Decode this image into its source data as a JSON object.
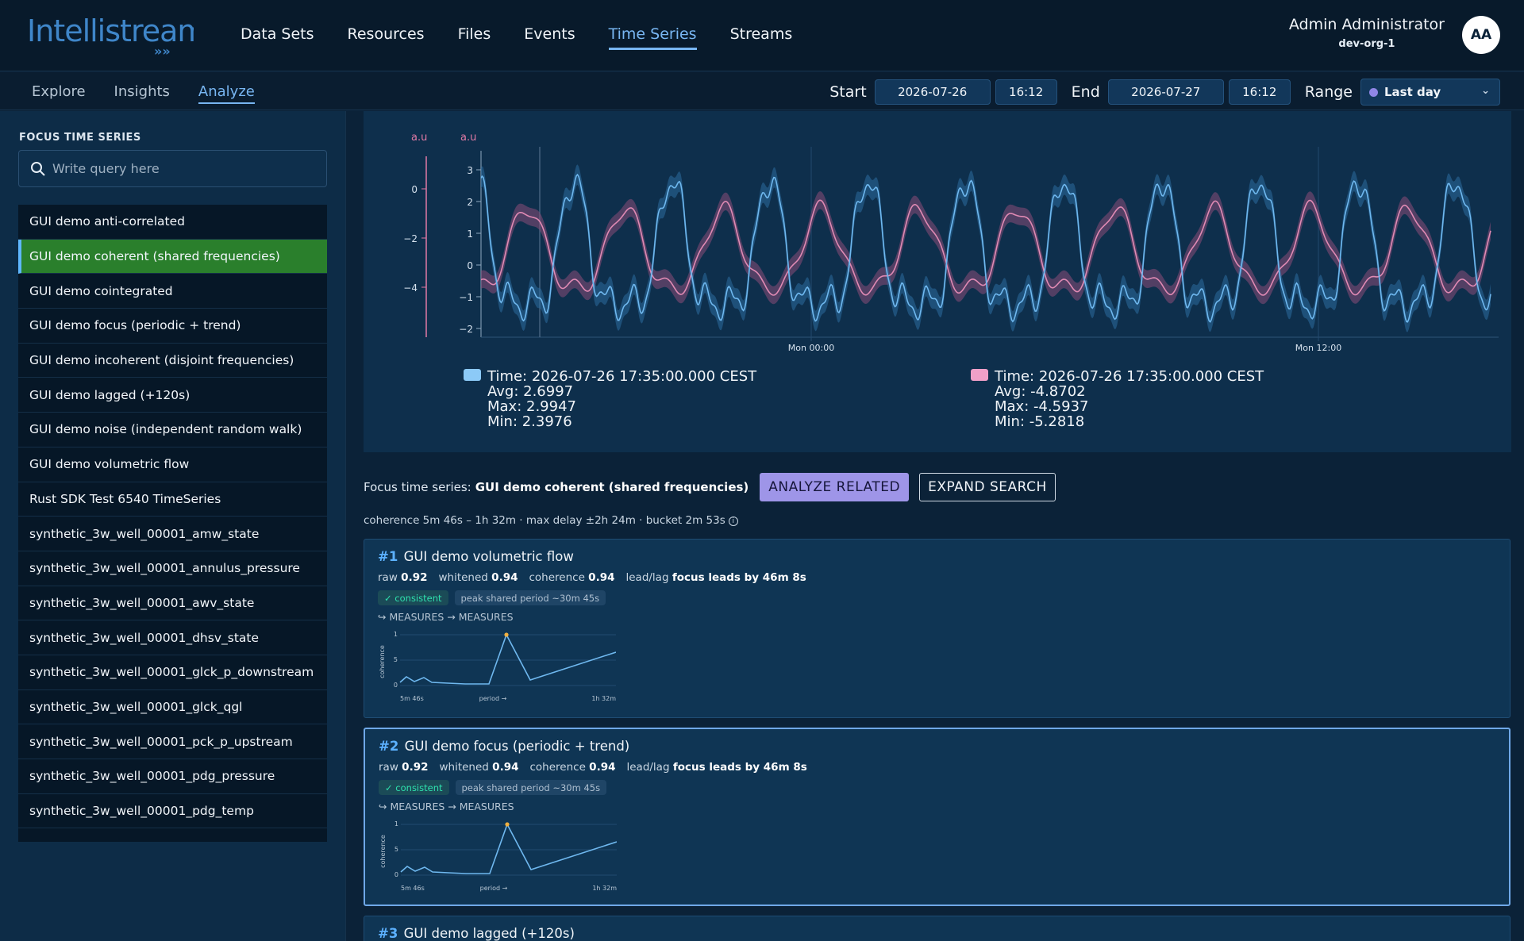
{
  "app": {
    "logo_text": "Intellistream"
  },
  "nav": {
    "items": [
      "Data Sets",
      "Resources",
      "Files",
      "Events",
      "Time Series",
      "Streams"
    ],
    "active": "Time Series"
  },
  "user": {
    "name": "Admin Administrator",
    "org": "dev-org-1",
    "initials": "AA"
  },
  "subnav": {
    "items": [
      "Explore",
      "Insights",
      "Analyze"
    ],
    "active": "Analyze"
  },
  "time_controls": {
    "start_label": "Start",
    "start_date": "2026-07-26",
    "start_time": "16:12",
    "end_label": "End",
    "end_date": "2026-07-27",
    "end_time": "16:12",
    "range_label": "Range",
    "range_value": "Last day"
  },
  "sidebar": {
    "title": "FOCUS TIME SERIES",
    "search_placeholder": "Write query here",
    "selected_index": 1,
    "items": [
      "GUI demo anti-correlated",
      "GUI demo coherent (shared frequencies)",
      "GUI demo cointegrated",
      "GUI demo focus (periodic + trend)",
      "GUI demo incoherent (disjoint frequencies)",
      "GUI demo lagged (+120s)",
      "GUI demo noise (independent random walk)",
      "GUI demo volumetric flow",
      "Rust SDK Test 6540 TimeSeries",
      "synthetic_3w_well_00001_amw_state",
      "synthetic_3w_well_00001_annulus_pressure",
      "synthetic_3w_well_00001_awv_state",
      "synthetic_3w_well_00001_dhsv_state",
      "synthetic_3w_well_00001_glck_p_downstream",
      "synthetic_3w_well_00001_glck_qgl",
      "synthetic_3w_well_00001_pck_p_upstream",
      "synthetic_3w_well_00001_pdg_pressure",
      "synthetic_3w_well_00001_pdg_temp"
    ]
  },
  "chart_data": {
    "type": "line",
    "left_axis": {
      "unit": "a.u",
      "ticks": [
        0,
        -2,
        -4
      ],
      "color": "#e07aa5"
    },
    "right_axis": {
      "unit": "a.u",
      "ticks": [
        3,
        2,
        1,
        0,
        -1,
        -2
      ],
      "ylim": [
        -2.2,
        3.4
      ]
    },
    "x_ticks": [
      "Mon 00:00",
      "Mon 12:00"
    ],
    "series": [
      {
        "color": "#6fb8ef",
        "shape": "periodic with sharp peaks near 3, troughs near -1.5"
      },
      {
        "color": "#e08ab4",
        "shape": "anti-phase periodic between -1.8 and 2"
      }
    ]
  },
  "legend": [
    {
      "color": "#8ccaf7",
      "time": "Time: 2026-07-26 17:35:00.000 CEST",
      "avg": "Avg: 2.6997",
      "max": "Max: 2.9947",
      "min": "Min: 2.3976"
    },
    {
      "color": "#f0a0c8",
      "time": "Time: 2026-07-26 17:35:00.000 CEST",
      "avg": "Avg: -4.8702",
      "max": "Max: -4.5937",
      "min": "Min: -5.2818"
    }
  ],
  "focus": {
    "label": "Focus time series:",
    "name": "GUI demo coherent (shared frequencies)",
    "analyze_button": "ANALYZE RELATED",
    "expand_button": "EXPAND SEARCH",
    "params": "coherence 5m 46s – 1h 32m · max delay ±2h 24m · bucket 2m 53s"
  },
  "cards": [
    {
      "rank": "#1",
      "name": "GUI demo volumetric flow",
      "raw_label": "raw",
      "raw": "0.92",
      "whitened_label": "whitened",
      "whitened": "0.94",
      "coherence_label": "coherence",
      "coherence": "0.94",
      "leadlag_label": "lead/lag",
      "leadlag": "focus leads by 46m 8s",
      "badge1": "✓ consistent",
      "badge2": "peak shared period ~30m 45s",
      "relation": "↪ MEASURES → MEASURES",
      "mini": {
        "ylabel": "coherence",
        "x_start": "5m 46s",
        "x_mid": "period →",
        "x_end": "1h 32m",
        "y_ticks": [
          "1",
          "5",
          "0"
        ]
      }
    },
    {
      "rank": "#2",
      "name": "GUI demo focus (periodic + trend)",
      "raw_label": "raw",
      "raw": "0.92",
      "whitened_label": "whitened",
      "whitened": "0.94",
      "coherence_label": "coherence",
      "coherence": "0.94",
      "leadlag_label": "lead/lag",
      "leadlag": "focus leads by 46m 8s",
      "badge1": "✓ consistent",
      "badge2": "peak shared period ~30m 45s",
      "relation": "↪ MEASURES → MEASURES",
      "mini": {
        "ylabel": "coherence",
        "x_start": "5m 46s",
        "x_mid": "period →",
        "x_end": "1h 32m",
        "y_ticks": [
          "1",
          "5",
          "0"
        ]
      }
    },
    {
      "rank": "#3",
      "name": "GUI demo lagged (+120s)"
    }
  ]
}
